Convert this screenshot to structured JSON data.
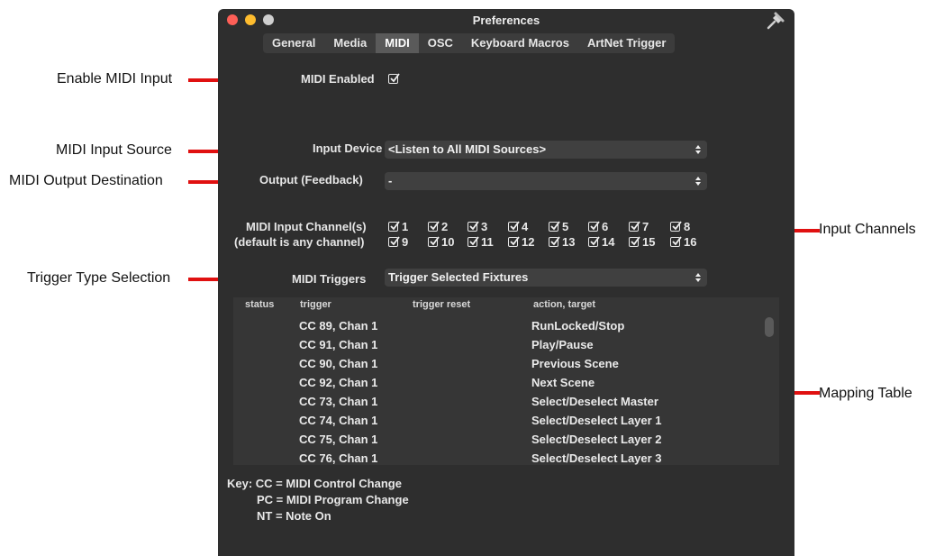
{
  "annotations": {
    "enable_midi_input": "Enable MIDI Input",
    "midi_input_source": "MIDI Input Source",
    "midi_output_destination": "MIDI Output Destination",
    "trigger_type_selection": "Trigger Type Selection",
    "input_channels": "Input Channels",
    "mapping_table": "Mapping Table"
  },
  "window": {
    "title": "Preferences",
    "tabs": [
      "General",
      "Media",
      "MIDI",
      "OSC",
      "Keyboard Macros",
      "ArtNet Trigger"
    ],
    "active_tab": "MIDI"
  },
  "midi_enabled": {
    "label": "MIDI Enabled",
    "checked": true
  },
  "input_device": {
    "label": "Input Device",
    "value": "<Listen to All MIDI Sources>"
  },
  "output_device": {
    "label": "Output (Feedback)",
    "value": "-"
  },
  "channels": {
    "label_line1": "MIDI Input Channel(s)",
    "label_line2": "(default is any channel)",
    "items": [
      "1",
      "2",
      "3",
      "4",
      "5",
      "6",
      "7",
      "8",
      "9",
      "10",
      "11",
      "12",
      "13",
      "14",
      "15",
      "16"
    ],
    "all_checked": true
  },
  "midi_triggers": {
    "label": "MIDI Triggers",
    "value": "Trigger Selected Fixtures"
  },
  "table": {
    "headers": [
      "status",
      "trigger",
      "trigger reset",
      "action, target"
    ],
    "rows": [
      {
        "trigger": "CC 89, Chan 1",
        "action": "RunLocked/Stop"
      },
      {
        "trigger": "CC 91, Chan 1",
        "action": "Play/Pause"
      },
      {
        "trigger": "CC 90, Chan 1",
        "action": "Previous Scene"
      },
      {
        "trigger": "CC 92, Chan 1",
        "action": "Next Scene"
      },
      {
        "trigger": "CC 73, Chan 1",
        "action": "Select/Deselect Master"
      },
      {
        "trigger": "CC 74, Chan 1",
        "action": "Select/Deselect Layer 1"
      },
      {
        "trigger": "CC 75, Chan 1",
        "action": "Select/Deselect Layer 2"
      },
      {
        "trigger": "CC 76, Chan 1",
        "action": "Select/Deselect Layer 3"
      }
    ]
  },
  "key": {
    "line1": "Key: CC = MIDI Control Change",
    "line2": "PC = MIDI Program Change",
    "line3": "NT = Note On"
  },
  "colors": {
    "annotation_line": "#e01010",
    "window_bg": "#2e2e2e"
  }
}
